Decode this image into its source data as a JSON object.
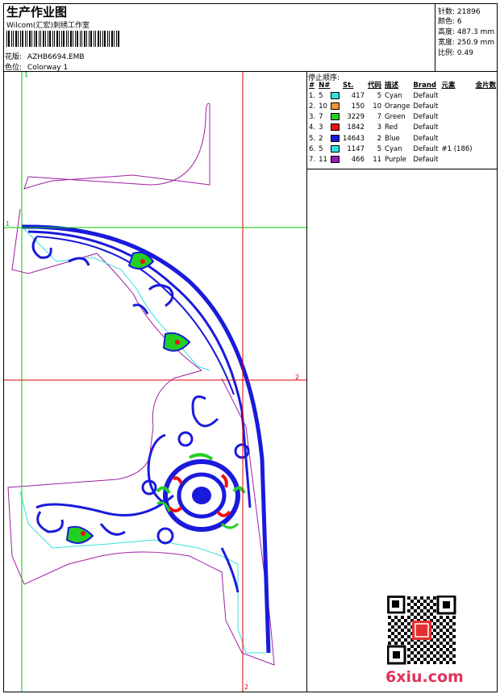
{
  "header": {
    "title": "生产作业图",
    "company": "Wilcom(汇宏)刺绣工作室",
    "design_label": "花版:",
    "design_value": "AZHB6694.EMB",
    "colorway_label": "色位:",
    "colorway_value": "Colorway 1"
  },
  "stats": {
    "stitches_label": "针数:",
    "stitches_value": "21896",
    "colors_label": "颜色:",
    "colors_value": "6",
    "height_label": "高度:",
    "height_value": "487.3 mm",
    "width_label": "宽度:",
    "width_value": "250.9 mm",
    "scale_label": "比例:",
    "scale_value": "0.49"
  },
  "stop_sequence": {
    "title": "停止顺序:",
    "headers": [
      "#",
      "N#",
      "St.",
      "代码",
      "描述",
      "Brand",
      "元素",
      "金片数"
    ],
    "rows": [
      {
        "idx": "1.",
        "n": "5",
        "color": "#33e0e0",
        "st": "417",
        "code": "5",
        "desc": "Cyan",
        "brand": "Default",
        "elem": "",
        "seq": ""
      },
      {
        "idx": "2.",
        "n": "10",
        "color": "#f0923a",
        "st": "150",
        "code": "10",
        "desc": "Orange",
        "brand": "Default",
        "elem": "",
        "seq": ""
      },
      {
        "idx": "3.",
        "n": "7",
        "color": "#22d022",
        "st": "3229",
        "code": "7",
        "desc": "Green",
        "brand": "Default",
        "elem": "",
        "seq": ""
      },
      {
        "idx": "4.",
        "n": "3",
        "color": "#ee1111",
        "st": "1842",
        "code": "3",
        "desc": "Red",
        "brand": "Default",
        "elem": "",
        "seq": ""
      },
      {
        "idx": "5.",
        "n": "2",
        "color": "#1a1adc",
        "st": "14643",
        "code": "2",
        "desc": "Blue",
        "brand": "Default",
        "elem": "",
        "seq": ""
      },
      {
        "idx": "6.",
        "n": "5",
        "color": "#33e0e0",
        "st": "1147",
        "code": "5",
        "desc": "Cyan",
        "brand": "Default",
        "elem": "#1 (186)",
        "seq": ""
      },
      {
        "idx": "7.",
        "n": "11",
        "color": "#9a1ab8",
        "st": "466",
        "code": "11",
        "desc": "Purple",
        "brand": "Default",
        "elem": "",
        "seq": ""
      }
    ]
  },
  "guides": {
    "green_1": "1",
    "green_2": "1",
    "red_1": "2",
    "red_2": "2"
  },
  "watermark": "6xiu.com",
  "colors": {
    "blue": "#1a1adc",
    "cyan": "#33e0e0",
    "purple": "#a020a0",
    "red_guide": "#dd0000",
    "green_guide": "#00cc00"
  }
}
